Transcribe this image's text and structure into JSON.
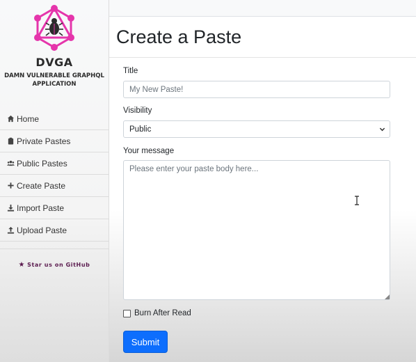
{
  "sidebar": {
    "brand": "DVGA",
    "brand_sub": "DAMN VULNERABLE GRAPHQL APPLICATION",
    "items": [
      {
        "label": "Home",
        "icon": "home-icon"
      },
      {
        "label": "Private Pastes",
        "icon": "clipboard-icon"
      },
      {
        "label": "Public Pastes",
        "icon": "users-icon"
      },
      {
        "label": "Create Paste",
        "icon": "plus-icon"
      },
      {
        "label": "Import Paste",
        "icon": "download-icon"
      },
      {
        "label": "Upload Paste",
        "icon": "upload-icon"
      }
    ],
    "github": "Star us on GitHub"
  },
  "main": {
    "title": "Create a Paste",
    "title_label": "Title",
    "title_placeholder": "My New Paste!",
    "visibility_label": "Visibility",
    "visibility_value": "Public",
    "message_label": "Your message",
    "message_placeholder": "Please enter your paste body here...",
    "burn_label": "Burn After Read",
    "submit_label": "Submit"
  },
  "colors": {
    "logo": "#e535ab",
    "primary": "#0d6efd",
    "github_text": "#5a1a4e"
  }
}
